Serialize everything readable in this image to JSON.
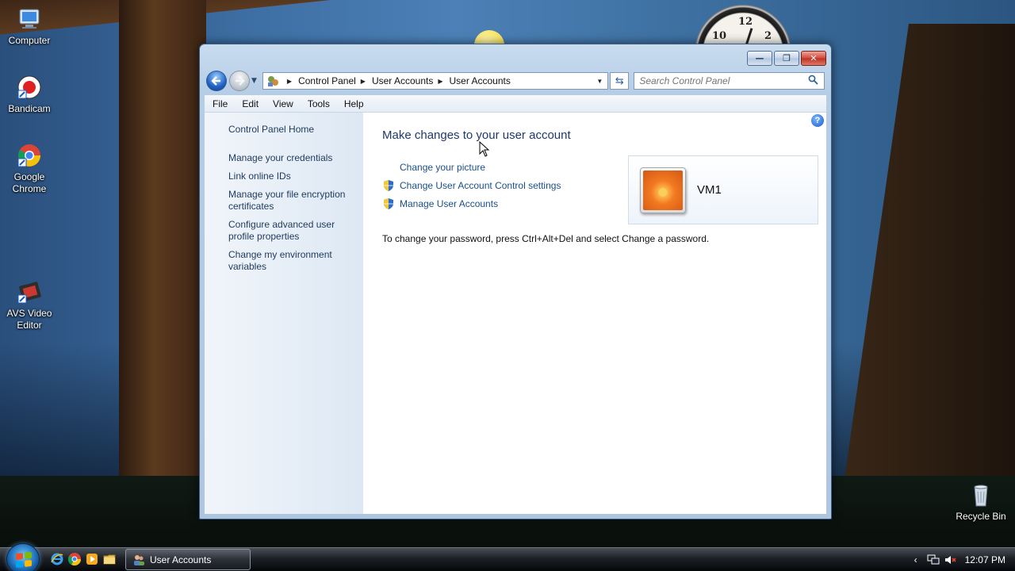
{
  "desktop": {
    "icons": [
      {
        "label": "Computer"
      },
      {
        "label": "Bandicam"
      },
      {
        "label": "Google Chrome"
      },
      {
        "label": "AVS Video Editor"
      },
      {
        "label": "Recycle Bin"
      }
    ]
  },
  "window": {
    "controls": {
      "minimize": "—",
      "maximize": "❐",
      "close": "✕"
    },
    "address": {
      "crumbs": [
        "Control Panel",
        "User Accounts",
        "User Accounts"
      ]
    },
    "search": {
      "placeholder": "Search Control Panel"
    },
    "menu": [
      "File",
      "Edit",
      "View",
      "Tools",
      "Help"
    ],
    "left_pane": {
      "home": "Control Panel Home",
      "tasks": [
        "Manage your credentials",
        "Link online IDs",
        "Manage your file encryption certificates",
        "Configure advanced user profile properties",
        "Change my environment variables"
      ]
    },
    "main": {
      "title": "Make changes to your user account",
      "links": [
        {
          "label": "Change your picture",
          "shield": false
        },
        {
          "label": "Change User Account Control settings",
          "shield": true
        },
        {
          "label": "Manage User Accounts",
          "shield": true
        }
      ],
      "note": "To change your password, press Ctrl+Alt+Del and select Change a password.",
      "account": {
        "name": "VM1"
      }
    }
  },
  "taskbar": {
    "task_button": "User Accounts",
    "time": "12:07 PM"
  },
  "colors": {
    "link": "#1b4f8a",
    "title": "#1e3a6b",
    "accent": "#1f62c2"
  }
}
